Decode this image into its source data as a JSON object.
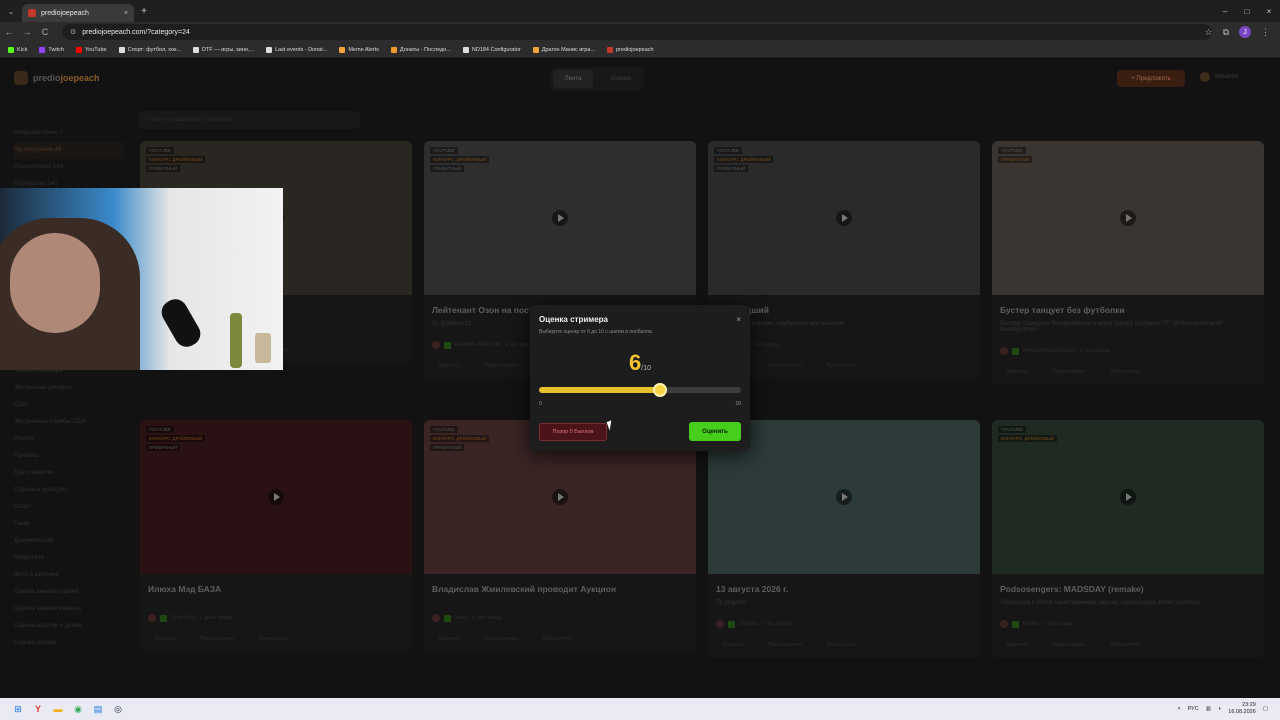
{
  "browser": {
    "tab_title": "prediojoepeach",
    "new_tab": "+",
    "tab_close": "×",
    "url": "prediojoepeach.com/?category=24",
    "profile_initial": "J",
    "window_controls": [
      "–",
      "□",
      "×"
    ],
    "nav": [
      "←",
      "→",
      "C"
    ],
    "bookmarks": [
      {
        "label": "Kick",
        "color": "#53fc18"
      },
      {
        "label": "Twitch",
        "color": "#9146ff"
      },
      {
        "label": "YouTube",
        "color": "#ff0000"
      },
      {
        "label": "Спорт: футбол, хок...",
        "color": "#dddddd"
      },
      {
        "label": "DTF — игры, кино,...",
        "color": "#dddddd"
      },
      {
        "label": "Last events - Donat...",
        "color": "#dddddd"
      },
      {
        "label": "Meme Alerts",
        "color": "#f2a33a"
      },
      {
        "label": "Донаты - Последн...",
        "color": "#f29a2e"
      },
      {
        "label": "ND184 Configurator",
        "color": "#dddddd"
      },
      {
        "label": "Драгон Манис игра...",
        "color": "#f2a33a"
      },
      {
        "label": "prediojoepeach",
        "color": "#c0392b"
      }
    ]
  },
  "site": {
    "logo_plain": "predio",
    "logo_accent": "joepeach",
    "tabs": [
      {
        "label": "Лента",
        "active": true
      },
      {
        "label": "Оценки",
        "active": false
      }
    ],
    "suggest_button": "+ Предложить",
    "user_name": "Streamer",
    "search_placeholder": "Поиск по названию и описанию",
    "sidebar": [
      {
        "label": "Непросмотрено 7",
        "active": false
      },
      {
        "label": "На смотрение 44",
        "active": true
      },
      {
        "label": "Просмотрено 164",
        "active": false
      },
      {
        "label": "Пропущено 141",
        "active": false
      },
      {
        "label": "",
        "active": false
      },
      {
        "label": "",
        "active": false
      },
      {
        "label": "",
        "active": false
      },
      {
        "label": "",
        "active": false
      },
      {
        "label": "",
        "active": false
      },
      {
        "label": "",
        "active": false
      },
      {
        "label": "",
        "active": false
      },
      {
        "label": "",
        "active": false
      },
      {
        "label": "",
        "active": false
      },
      {
        "label": "Конкурс Дрейфовый",
        "active": false
      },
      {
        "label": "Кольца стримера",
        "active": false
      },
      {
        "label": "Экстренная движуха",
        "active": false
      },
      {
        "label": "США",
        "active": false
      },
      {
        "label": "Экстренные службы США",
        "active": false
      },
      {
        "label": "Россия",
        "active": false
      },
      {
        "label": "Приколы",
        "active": false
      },
      {
        "label": "Еда и напитки",
        "active": false
      },
      {
        "label": "Страны и культуры",
        "active": false
      },
      {
        "label": "Спорт",
        "active": false
      },
      {
        "label": "Гонки",
        "active": false
      },
      {
        "label": "Документалки",
        "active": false
      },
      {
        "label": "Нейросети",
        "active": false
      },
      {
        "label": "Фото и картинки",
        "active": false
      },
      {
        "label": "Оценка внешки парней",
        "active": false
      },
      {
        "label": "Оценка внешки женщин",
        "active": false
      },
      {
        "label": "Оценка квартир и домов",
        "active": false
      },
      {
        "label": "Оценка дизайн",
        "active": false
      }
    ],
    "cards": [
      {
        "tags": [
          "YOUTUBE",
          "КОНКУРС: ДРОЙФОВЫЙ",
          "ПРИВАТНЫЙ"
        ],
        "title": "",
        "desc": "",
        "author": "",
        "time": "",
        "thumb": "#2a2622"
      },
      {
        "tags": [
          "YOUTUBE",
          "КОНКУРС: ДРОЙФОВЫЙ",
          "ПРИВАТНЫЙ"
        ],
        "title": "Лейтенант Озон на пост",
        "desc": "Тг @dencry12",
        "author": "ROMAN PRAVDIN",
        "time": "1 час назад",
        "thumb": "#2e2e2e"
      },
      {
        "tags": [
          "YOUTUBE",
          "КОНКУРС: ДРОЙФОВЫЙ",
          "ПРИВАТНЫЙ"
        ],
        "title": "ов Младший",
        "desc": "toGSfer и. с. миниры, следующих все пишите",
        "author": "Bk",
        "time": "1 час назад",
        "thumb": "#2a2a2a"
      },
      {
        "tags": [
          "YOUTUBE",
          "ПРИВАТНЫЙ"
        ],
        "title": "Бустер танцует без футболки",
        "desc": "Бустер танцует без футболки в кругу друзей из Армии ТГ: @VeteranArmenM; hearingArmen",
        "author": "ArmenMeManDawwn",
        "time": "1 час назад",
        "thumb": "#3a3530"
      },
      {
        "tags": [
          "YOUTUBE",
          "КОНКУРС: ДРОЙФОВЫЙ",
          "ПРИВАТНЫЙ"
        ],
        "title": "Илюха Мэд БАЗА",
        "desc": "",
        "author": "Sher-Mod",
        "time": "1 день назад",
        "thumb": "#2a1214"
      },
      {
        "tags": [
          "YOUTUBE",
          "КОНКУРС: ДРОЙФОВЫЙ",
          "ПРИВАТНЫЙ"
        ],
        "title": "Владислав Жмилевский проводит Аукцион",
        "desc": "",
        "author": "Vkus",
        "time": "1 час назад",
        "thumb": "#3a2424"
      },
      {
        "tags": [
          "YOUTUBE"
        ],
        "title": "13 августа 2026 г.",
        "desc": "Тг @ayziln",
        "author": "Scorpio",
        "time": "1 час назад",
        "thumb": "#2c3a3a"
      },
      {
        "tags": [
          "YOUTUBE",
          "КОНКУРС: ДРОЙФОВЫЙ"
        ],
        "title": "Podsosengers: MADSDAY (remake)",
        "desc": "Перезалив с более качественным звуком, предыдущее видео удалено.",
        "author": "Нейка",
        "time": "1 час назад",
        "thumb": "#1e2a22"
      }
    ],
    "card_actions": [
      "Оценить",
      "Просмотрено",
      "Пропустить"
    ]
  },
  "modal": {
    "title": "Оценка стримера",
    "subtitle": "Выберите оценку от 0 до 10 с шагом в полбалла.",
    "close": "×",
    "score": "6",
    "score_suffix": "/10",
    "slider_value": 0.6,
    "min_label": "0",
    "max_label": "10",
    "shame_button": "Позор 0 Баллов",
    "rate_button": "Оценить"
  },
  "taskbar": {
    "lang": "РУС",
    "time": "23:29",
    "date": "16.08.2026"
  }
}
